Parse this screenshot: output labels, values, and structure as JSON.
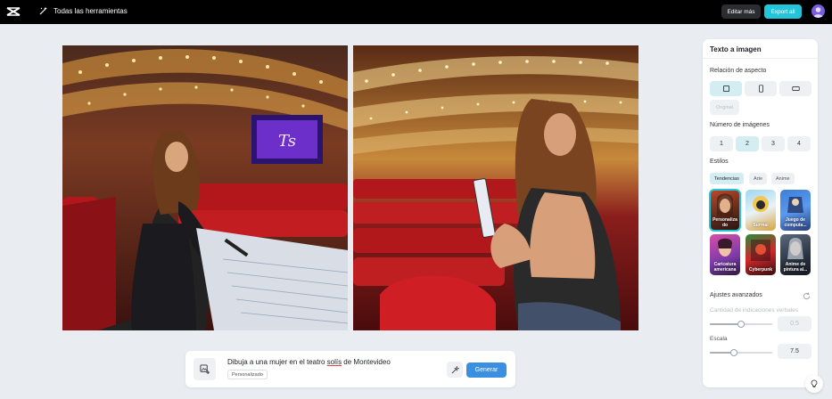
{
  "header": {
    "tools_label": "Todas las herramientas",
    "edit_more_label": "Editar más",
    "export_all_label": "Export all"
  },
  "canvas": {
    "images": [
      {
        "name": "generated-image-1"
      },
      {
        "name": "generated-image-2"
      }
    ]
  },
  "prompt": {
    "text_before": "Dibuja a una mujer en el teatro ",
    "text_underlined": "solís",
    "text_after": " de Montevideo",
    "style_tag": "Personalizado",
    "generate_label": "Generar"
  },
  "panel": {
    "title": "Texto a imagen",
    "aspect_ratio": {
      "label": "Relación de aspecto",
      "options": [
        "square",
        "portrait",
        "landscape"
      ],
      "selected": "square",
      "original_label": "Original"
    },
    "image_count": {
      "label": "Número de imágenes",
      "options": [
        "1",
        "2",
        "3",
        "4"
      ],
      "selected": "2"
    },
    "styles": {
      "label": "Estilos",
      "tabs": [
        "Tendencias",
        "Arte",
        "Anime"
      ],
      "selected_tab": "Tendencias",
      "items": [
        {
          "label": "Personalizado",
          "display": "Personaliza do"
        },
        {
          "label": "Surreal",
          "display": "Surreal"
        },
        {
          "label": "Juego de computadora",
          "display": "Juego de computa..."
        },
        {
          "label": "Caricatura americana",
          "display": "Caricatura americana"
        },
        {
          "label": "Cyberpunk",
          "display": "Cyberpunk"
        },
        {
          "label": "Anime de pintura al óleo",
          "display": "Anime de pintura al..."
        }
      ],
      "selected": "Personalizado"
    },
    "advanced": {
      "label": "Ajustes avanzados",
      "prompt_strength": {
        "label": "Cantidad de indicaciones verbales",
        "value": "0.5",
        "fraction": 0.5
      },
      "scale": {
        "label": "Escala",
        "value": "7.5",
        "fraction": 0.38
      }
    }
  },
  "colors": {
    "accent": "#22c5da",
    "generate": "#3b8fe0",
    "selected_bg": "#d3edf2",
    "topbar": "#000000"
  }
}
